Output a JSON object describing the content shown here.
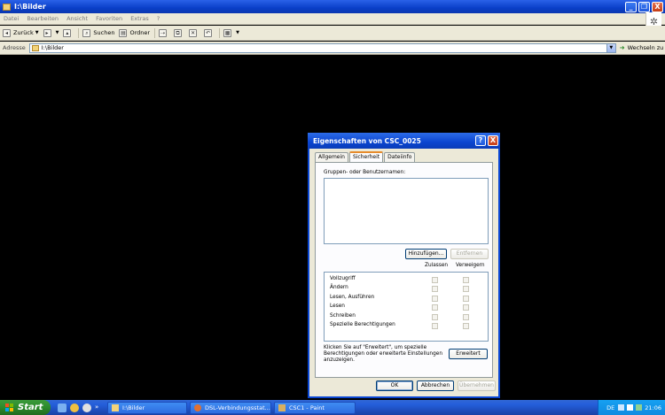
{
  "window": {
    "title": "I:\\Bilder",
    "min_label": "_",
    "max_label": "❐",
    "close_label": "X"
  },
  "menu": [
    "Datei",
    "Bearbeiten",
    "Ansicht",
    "Favoriten",
    "Extras",
    "?"
  ],
  "toolbar": {
    "back_label": "Zurück",
    "search_label": "Suchen",
    "folders_label": "Ordner"
  },
  "address": {
    "label": "Adresse",
    "value": "I:\\Bilder",
    "go_label": "Wechseln zu"
  },
  "dialog": {
    "title": "Eigenschaften von CSC_0025",
    "help_label": "?",
    "close_label": "X",
    "tabs": [
      "Allgemein",
      "Sicherheit",
      "Dateiinfo"
    ],
    "active_tab": "Sicherheit",
    "groups_label": "Gruppen- oder Benutzernamen:",
    "add_label": "Hinzufügen...",
    "remove_label": "Entfernen",
    "allow_label": "Zulassen",
    "deny_label": "Verweigern",
    "permissions": [
      "Vollzugriff",
      "Ändern",
      "Lesen, Ausführen",
      "Lesen",
      "Schreiben",
      "Spezielle Berechtigungen"
    ],
    "note": "Klicken Sie auf \"Erweitert\", um spezielle Berechtigungen oder erweiterte Einstellungen anzuzeigen.",
    "advanced_label": "Erweitert",
    "ok_label": "OK",
    "cancel_label": "Abbrechen",
    "apply_label": "Übernehmen"
  },
  "taskbar": {
    "start_label": "Start",
    "tasks": [
      "I:\\Bilder",
      "DSL-Verbindungsstat...",
      "CSC1 - Paint"
    ],
    "clock": "21:06",
    "lang": "DE"
  }
}
